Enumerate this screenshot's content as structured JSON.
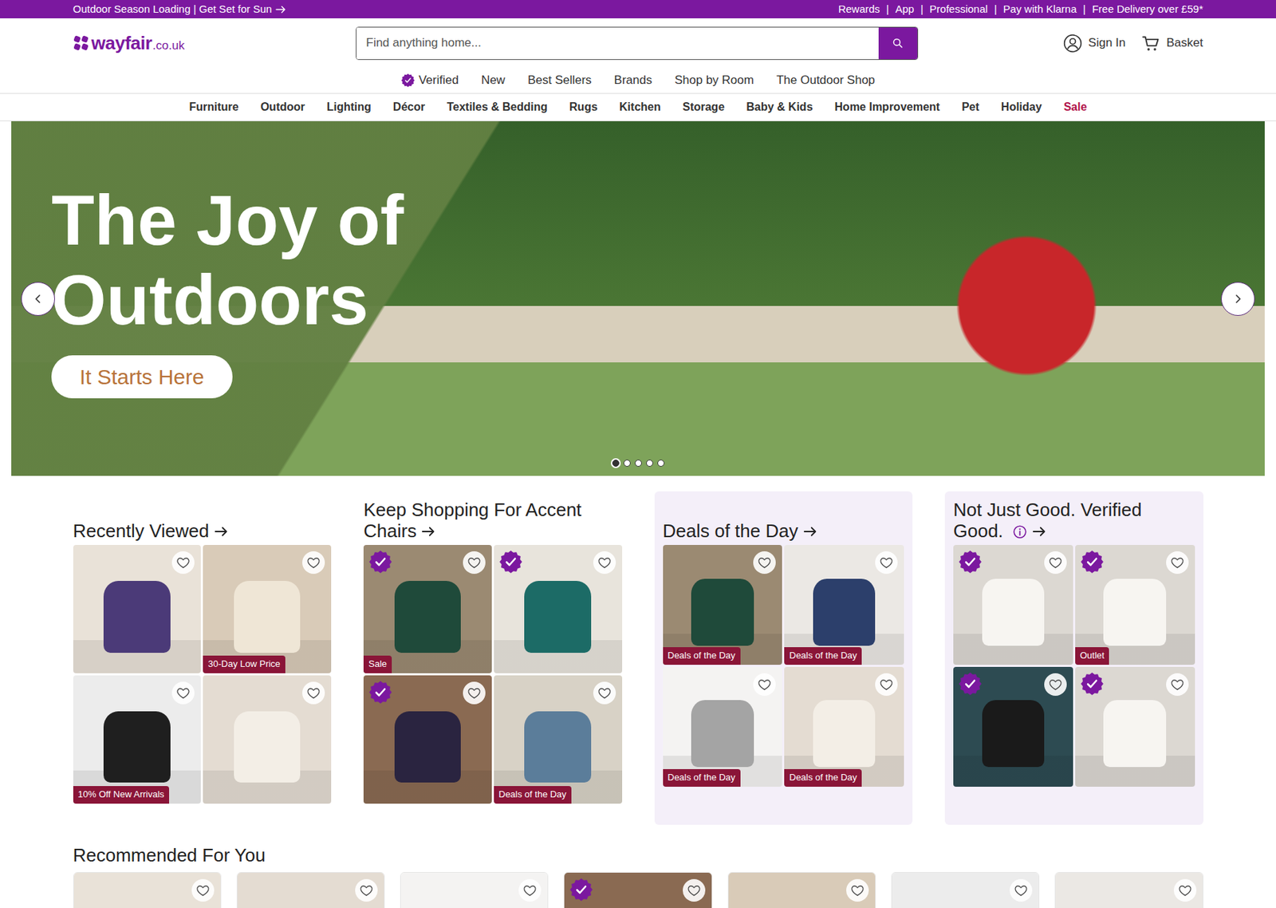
{
  "promo_bar": {
    "message": "Outdoor Season Loading | Get Set for Sun",
    "separator": "|",
    "links": [
      "Rewards",
      "App",
      "Professional",
      "Pay with Klarna",
      "Free Delivery over £59*"
    ]
  },
  "logo": {
    "name": "wayfair",
    "domain": ".co.uk"
  },
  "search": {
    "placeholder": "Find anything home..."
  },
  "account": {
    "sign_in": "Sign In",
    "basket": "Basket"
  },
  "secondary_nav": [
    {
      "label": "Verified",
      "kind": "verified"
    },
    {
      "label": "New",
      "kind": "plain"
    },
    {
      "label": "Best Sellers",
      "kind": "plain"
    },
    {
      "label": "Brands",
      "kind": "plain"
    },
    {
      "label": "Shop by Room",
      "kind": "plain"
    },
    {
      "label": "The Outdoor Shop",
      "kind": "plain"
    }
  ],
  "categories": [
    {
      "label": "Furniture",
      "kind": "regular"
    },
    {
      "label": "Outdoor",
      "kind": "regular"
    },
    {
      "label": "Lighting",
      "kind": "regular"
    },
    {
      "label": "Décor",
      "kind": "regular"
    },
    {
      "label": "Textiles & Bedding",
      "kind": "regular"
    },
    {
      "label": "Rugs",
      "kind": "regular"
    },
    {
      "label": "Kitchen",
      "kind": "regular"
    },
    {
      "label": "Storage",
      "kind": "regular"
    },
    {
      "label": "Baby & Kids",
      "kind": "regular"
    },
    {
      "label": "Home Improvement",
      "kind": "regular"
    },
    {
      "label": "Pet",
      "kind": "regular"
    },
    {
      "label": "Holiday",
      "kind": "regular"
    },
    {
      "label": "Sale",
      "kind": "sale"
    }
  ],
  "hero": {
    "title": [
      "The Joy of",
      "Outdoors"
    ],
    "button": "It Starts Here",
    "slides": [
      {
        "selected": true
      },
      {
        "selected": false
      },
      {
        "selected": false
      },
      {
        "selected": false
      },
      {
        "selected": false
      }
    ]
  },
  "sections": [
    {
      "title": "Recently Viewed",
      "kind": "plain",
      "products": [
        {
          "verified": false,
          "saved": false
        },
        {
          "badge": "30-Day Low Price",
          "verified": false,
          "saved": false
        },
        {
          "badge": "10% Off New Arrivals",
          "verified": false,
          "saved": false
        },
        {
          "verified": false,
          "saved": false
        }
      ]
    },
    {
      "title": "Keep Shopping For Accent Chairs",
      "kind": "plain",
      "products": [
        {
          "badge": "Sale",
          "verified": true,
          "saved": false
        },
        {
          "verified": true,
          "saved": false
        },
        {
          "verified": true,
          "saved": false
        },
        {
          "badge": "Deals of the Day",
          "verified": false,
          "saved": false
        }
      ]
    },
    {
      "title": "Deals of the Day",
      "kind": "deals",
      "products": [
        {
          "badge": "Deals of the Day",
          "verified": false,
          "saved": false
        },
        {
          "badge": "Deals of the Day",
          "verified": false,
          "saved": false
        },
        {
          "badge": "Deals of the Day",
          "verified": false,
          "saved": false
        },
        {
          "badge": "Deals of the Day",
          "verified": false,
          "saved": false
        }
      ]
    },
    {
      "title": "Not Just Good. Verified Good.",
      "kind": "verified",
      "products": [
        {
          "verified": true,
          "saved": false
        },
        {
          "badge": "Outlet",
          "verified": true,
          "saved": false
        },
        {
          "verified": true,
          "saved": false
        },
        {
          "verified": true,
          "saved": false
        }
      ]
    }
  ],
  "recommended": {
    "title": "Recommended For You",
    "products": [
      {
        "verified": false,
        "saved": false
      },
      {
        "verified": false,
        "saved": false
      },
      {
        "verified": false,
        "saved": false
      },
      {
        "verified": true,
        "saved": false
      },
      {
        "verified": false,
        "saved": false
      },
      {
        "verified": false,
        "saved": false
      },
      {
        "verified": false,
        "saved": false
      }
    ]
  }
}
